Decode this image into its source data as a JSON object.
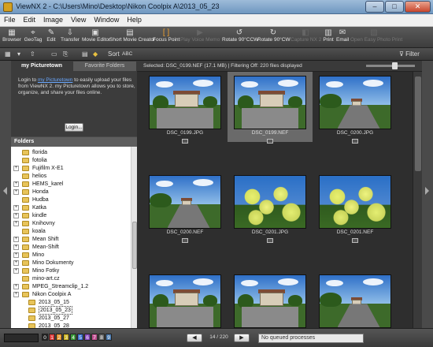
{
  "window": {
    "title": "ViewNX 2 - C:\\Users\\Mino\\Desktop\\Nikon Coolpix A\\2013_05_23",
    "minimize": "–",
    "maximize": "□",
    "close": "✕"
  },
  "menu": [
    "File",
    "Edit",
    "Image",
    "View",
    "Window",
    "Help"
  ],
  "toolbar": [
    {
      "label": "Browser",
      "icon": "browser-icon",
      "glyph": "▦"
    },
    {
      "label": "GeoTag",
      "icon": "geotag-icon",
      "glyph": "⌖"
    },
    {
      "label": "Edit",
      "icon": "edit-icon",
      "glyph": "✎"
    },
    {
      "label": "Transfer",
      "icon": "transfer-icon",
      "glyph": "⇩"
    },
    {
      "label": "Movie Editor",
      "icon": "movie-editor-icon",
      "glyph": "▣"
    },
    {
      "label": "Short Movie Creator",
      "icon": "short-movie-icon",
      "glyph": "▤"
    },
    {
      "label": "Focus Point",
      "icon": "focus-point-icon",
      "glyph": "[ ]"
    },
    {
      "label": "Play Voice Memo",
      "icon": "voice-memo-icon",
      "glyph": "▶"
    },
    {
      "label": "Rotate 90°CCW",
      "icon": "rotate-ccw-icon",
      "glyph": "↺"
    },
    {
      "label": "Rotate 90°CW",
      "icon": "rotate-cw-icon",
      "glyph": "↻"
    },
    {
      "label": "Capture NX 2",
      "icon": "capture-nx-icon",
      "glyph": "◧"
    },
    {
      "label": "Print",
      "icon": "print-icon",
      "glyph": "▥"
    },
    {
      "label": "Email",
      "icon": "email-icon",
      "glyph": "✉"
    },
    {
      "label": "Open Easy Photo Print",
      "icon": "easy-print-icon",
      "glyph": "▧"
    },
    {
      "label": "Filter",
      "icon": "filter-icon",
      "glyph": "⊽"
    }
  ],
  "toolbar2": {
    "sort_label": "Sort",
    "sort_value": "ABC"
  },
  "picturetown": {
    "tabs": [
      "my Picturetown",
      "Favorite Folders"
    ],
    "text_before": "Login to ",
    "link": "my Picturetown",
    "text_after": " to easily upload your files from ViewNX 2. my Picturetown allows you to store, organize, and share your files online.",
    "login_button": "Login..."
  },
  "folders": {
    "header": "Folders",
    "items": [
      {
        "name": "florida",
        "expandable": false,
        "indent": 0
      },
      {
        "name": "fotolia",
        "expandable": false,
        "indent": 0
      },
      {
        "name": "Fujifilm X-E1",
        "expandable": true,
        "indent": 0
      },
      {
        "name": "helios",
        "expandable": false,
        "indent": 0
      },
      {
        "name": "HEMS_karel",
        "expandable": true,
        "indent": 0
      },
      {
        "name": "Honda",
        "expandable": true,
        "indent": 0
      },
      {
        "name": "Hudba",
        "expandable": false,
        "indent": 0
      },
      {
        "name": "Katka",
        "expandable": true,
        "indent": 0
      },
      {
        "name": "kindle",
        "expandable": true,
        "indent": 0
      },
      {
        "name": "Knihovny",
        "expandable": true,
        "indent": 0
      },
      {
        "name": "koala",
        "expandable": false,
        "indent": 0
      },
      {
        "name": "Mean Shift",
        "expandable": true,
        "indent": 0
      },
      {
        "name": "Mean-Shift",
        "expandable": true,
        "indent": 0
      },
      {
        "name": "Mino",
        "expandable": true,
        "indent": 0
      },
      {
        "name": "Mino Dokumenty",
        "expandable": true,
        "indent": 0
      },
      {
        "name": "Mino Fotky",
        "expandable": true,
        "indent": 0
      },
      {
        "name": "mino-art.cz",
        "expandable": false,
        "indent": 0
      },
      {
        "name": "MPEG_Streamclip_1.2",
        "expandable": true,
        "indent": 0
      },
      {
        "name": "Nikon Coolpix A",
        "expandable": true,
        "indent": 0
      },
      {
        "name": "2013_05_15",
        "expandable": false,
        "indent": 1
      },
      {
        "name": "2013_05_23",
        "expandable": false,
        "indent": 1,
        "selected": true
      },
      {
        "name": "2013_05_27",
        "expandable": false,
        "indent": 1
      },
      {
        "name": "2013_05_28",
        "expandable": false,
        "indent": 1
      }
    ]
  },
  "infobar": {
    "text": "Selected: DSC_0199.NEF (17.1 MB) | Filtering Off: 220 files displayed",
    "zoom_level": 0.6
  },
  "thumbnails": [
    {
      "name": "DSC_0199.JPG",
      "scene": "house",
      "selected": false
    },
    {
      "name": "DSC_0199.NEF",
      "scene": "house",
      "selected": true
    },
    {
      "name": "DSC_0200.JPG",
      "scene": "road",
      "selected": false
    },
    {
      "name": "DSC_0200.NEF",
      "scene": "road",
      "selected": false
    },
    {
      "name": "DSC_0201.JPG",
      "scene": "flowers",
      "selected": false
    },
    {
      "name": "DSC_0201.NEF",
      "scene": "flowers",
      "selected": false
    }
  ],
  "status": {
    "label_numbers": [
      "0",
      "1",
      "2",
      "3",
      "4",
      "5",
      "6",
      "7",
      "8",
      "9"
    ],
    "label_colors": [
      "#222222",
      "#d83a3a",
      "#e0902a",
      "#c8b020",
      "#3a9a3a",
      "#3a70d0",
      "#8a4ac0",
      "#c05090",
      "#6a6a6a",
      "#4a7ab0"
    ],
    "page": "14 / 220",
    "prev": "◀",
    "next": "▶",
    "queue": "No queued processes"
  },
  "colors": {
    "selection": "#6a6a6a",
    "link": "#6aa8ff"
  }
}
